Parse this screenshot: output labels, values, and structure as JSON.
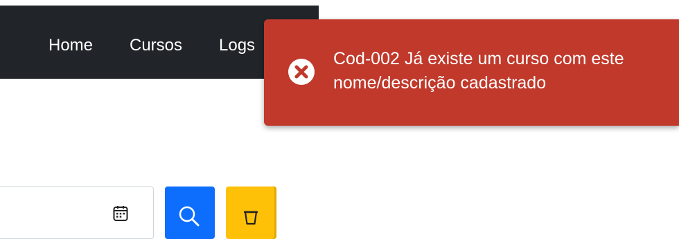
{
  "navbar": {
    "links": [
      "Home",
      "Cursos",
      "Logs"
    ],
    "background": "#212529"
  },
  "toast": {
    "type": "error",
    "icon": "error-circle-x-icon",
    "message": "Cod-002 Já existe um curso com este nome/descrição cadastrado",
    "background": "#c0392b"
  },
  "filters": {
    "date_input": {
      "value": "",
      "icon": "calendar-icon"
    },
    "search_button": {
      "icon": "search-icon",
      "color": "#0d6efd"
    },
    "clear_button": {
      "icon": "trash-icon",
      "color": "#ffc107"
    }
  }
}
